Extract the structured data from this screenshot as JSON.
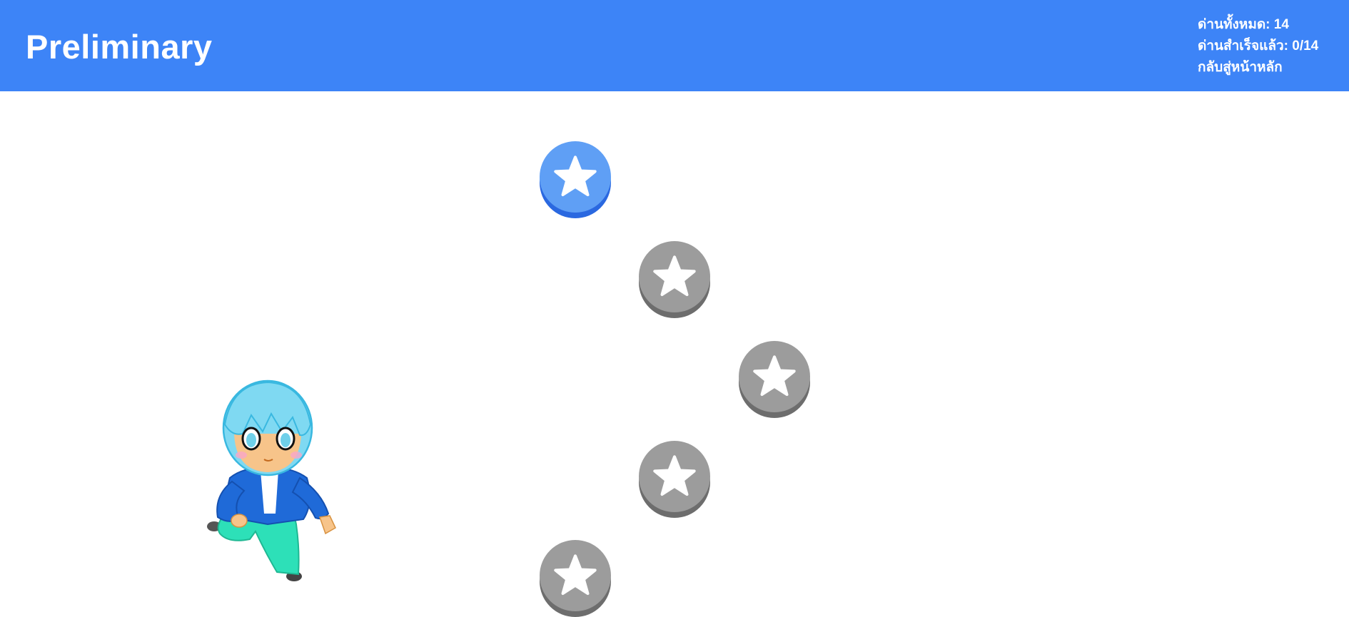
{
  "header": {
    "title": "Preliminary",
    "total_levels_text": "ด่านทั้งหมด: 14",
    "completed_levels_text": "ด่านสำเร็จแล้ว: 0/14",
    "home_link_text": "กลับสู่หน้าหลัก",
    "background_color": "#3d84f7"
  },
  "levels": [
    {
      "state": "active",
      "icon": "star-icon"
    },
    {
      "state": "locked",
      "icon": "star-icon"
    },
    {
      "state": "locked",
      "icon": "star-icon"
    },
    {
      "state": "locked",
      "icon": "star-icon"
    },
    {
      "state": "locked",
      "icon": "star-icon"
    }
  ],
  "colors": {
    "active_level": "#5f9ff5",
    "locked_level": "#9c9c9c",
    "star": "#ffffff"
  },
  "character": {
    "icon": "chibi-character-illustration"
  }
}
